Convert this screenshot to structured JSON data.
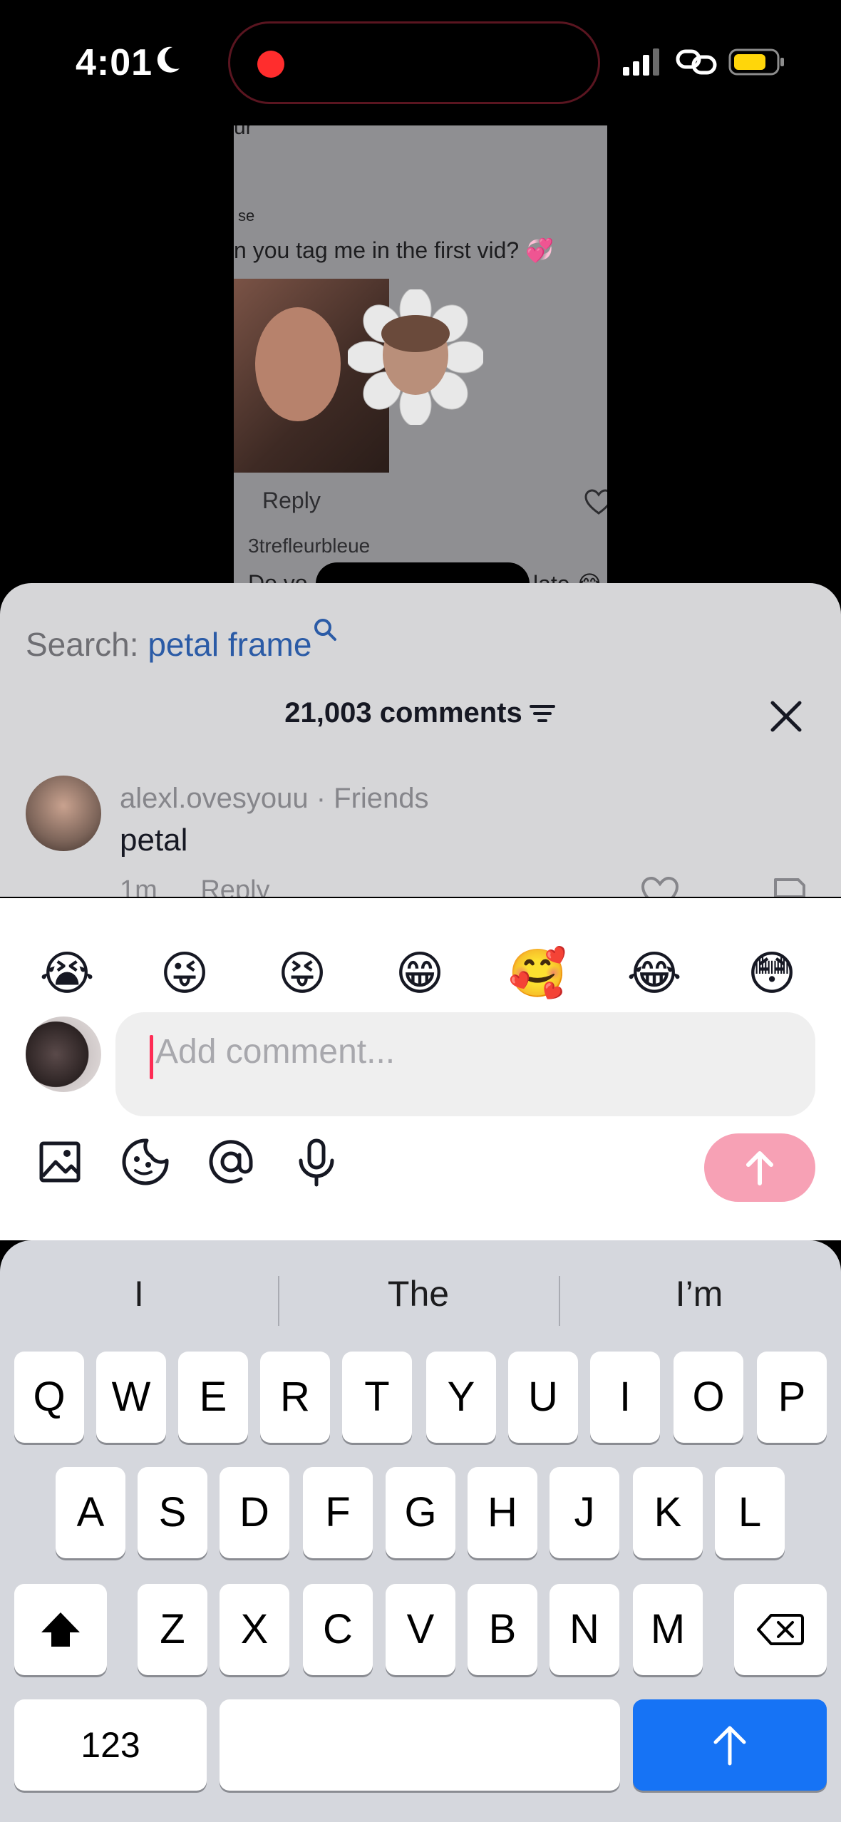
{
  "status_bar": {
    "time": "4:01",
    "icons": [
      "moon-icon",
      "recording-dot-icon",
      "cellular-signal-icon",
      "link-icon",
      "battery-icon"
    ],
    "battery_color": "#ffd60a",
    "recording_color": "#ff2d2d"
  },
  "video": {
    "line_top": "ur",
    "line_2": "se",
    "line_3": "n you tag me in the first vid? 💞",
    "reply": "Reply",
    "user_below": "3trefleurbleue",
    "partial_text_left": "Do yo",
    "partial_text_right": "late 😂"
  },
  "comments_panel": {
    "search_label": "Search:",
    "search_term": "petal frame",
    "count_label": "21,003 comments",
    "comment": {
      "username": "alexl.ovesyouu",
      "relation": "· Friends",
      "text": "petal",
      "time": "1m",
      "reply": "Reply"
    }
  },
  "composer": {
    "emojis": [
      "😭",
      "😜",
      "😝",
      "😁",
      "🥰",
      "😂",
      "😳"
    ],
    "placeholder": "Add comment...",
    "tools": [
      "image-icon",
      "sticker-icon",
      "mention-icon",
      "microphone-icon"
    ],
    "send_color": "#f7a1b5",
    "caret_color": "#fe2c55"
  },
  "keyboard": {
    "suggestions": [
      "I",
      "The",
      "I’m"
    ],
    "row1": [
      "Q",
      "W",
      "E",
      "R",
      "T",
      "Y",
      "U",
      "I",
      "O",
      "P"
    ],
    "row2": [
      "A",
      "S",
      "D",
      "F",
      "G",
      "H",
      "J",
      "K",
      "L"
    ],
    "row3": [
      "Z",
      "X",
      "C",
      "V",
      "B",
      "N",
      "M"
    ],
    "numbers_key": "123",
    "return_color": "#1673f5"
  }
}
